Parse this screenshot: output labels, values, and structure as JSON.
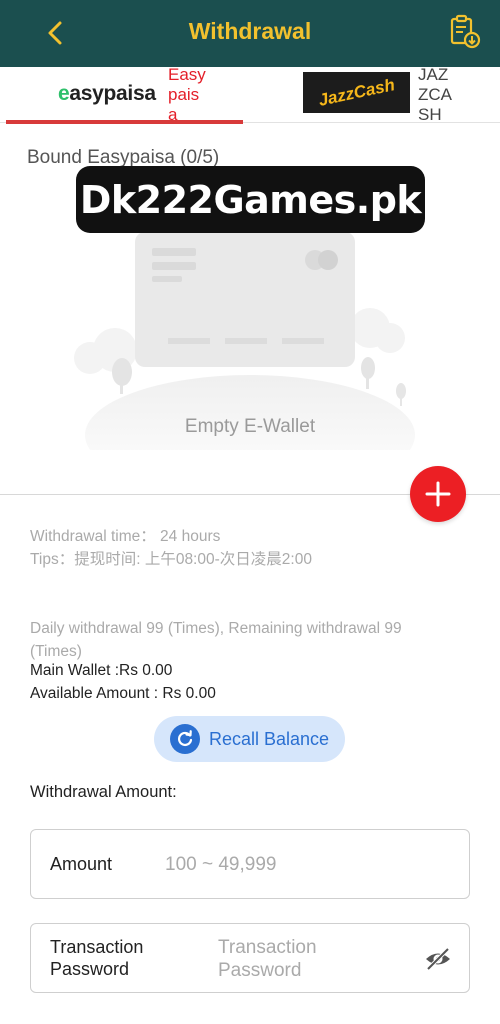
{
  "header": {
    "title": "Withdrawal",
    "back_icon": "chevron-left-icon",
    "record_icon": "clipboard-download-icon"
  },
  "tabs": [
    {
      "logo": "easypaisa",
      "label": "Easypaisa",
      "active": true
    },
    {
      "logo": "JazzCash",
      "label": "JAZZCASH",
      "active": false
    }
  ],
  "bound": {
    "title": "Bound Easypaisa (0/5)",
    "empty_text": "Empty E-Wallet"
  },
  "watermark": "Dk222Games.pk",
  "info": {
    "withdrawal_time": "Withdrawal time：  24 hours",
    "tips": "Tips：提现时间: 上午08:00-次日凌晨2:00",
    "daily": "Daily withdrawal 99 (Times), Remaining withdrawal 99 (Times)",
    "main_wallet": "Main Wallet :Rs 0.00",
    "available": "Available Amount : Rs 0.00"
  },
  "recall": {
    "label": "Recall Balance"
  },
  "form": {
    "section_title": "Withdrawal Amount:",
    "amount_label": "Amount",
    "amount_placeholder": "100 ~ 49,999",
    "password_label": "Transaction Password",
    "password_placeholder": "Transaction Password"
  },
  "colors": {
    "header_bg": "#1b4f4f",
    "title": "#f2c12e",
    "accent_red": "#ec1f24",
    "recall_blue": "#2a6fd1"
  }
}
